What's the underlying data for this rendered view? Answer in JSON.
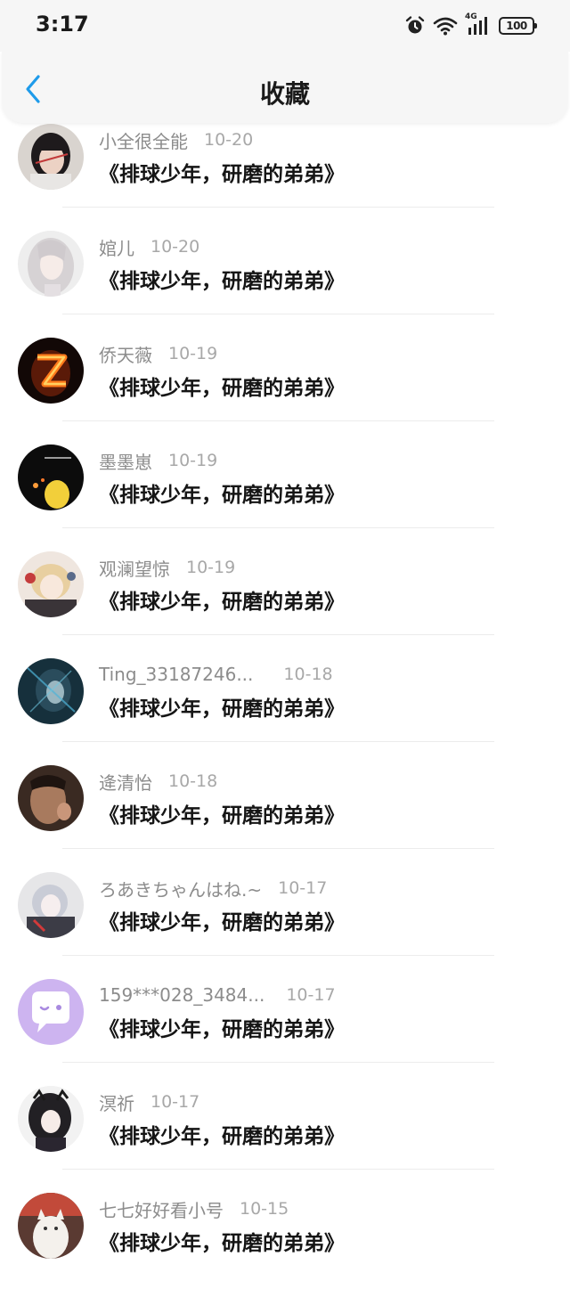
{
  "status_bar": {
    "time": "3:17",
    "network": "4G",
    "battery": "100",
    "icons": [
      "alarm-icon",
      "wifi-icon",
      "signal-icon",
      "battery-icon"
    ]
  },
  "header": {
    "title": "收藏",
    "back_icon": "chevron-left-icon",
    "accent_color": "#1e9bea"
  },
  "items": [
    {
      "username": "小全很全能",
      "date": "10-20",
      "title": "《排球少年，研磨的弟弟》",
      "avatar": "avatar-photo-icon"
    },
    {
      "username": "婠儿",
      "date": "10-20",
      "title": "《排球少年，研磨的弟弟》",
      "avatar": "avatar-anime-icon"
    },
    {
      "username": "侨天薇",
      "date": "10-19",
      "title": "《排球少年，研磨的弟弟》",
      "avatar": "avatar-fire-letter-icon"
    },
    {
      "username": "墨墨崽",
      "date": "10-19",
      "title": "《排球少年，研磨的弟弟》",
      "avatar": "avatar-dark-icon"
    },
    {
      "username": "观澜望惊",
      "date": "10-19",
      "title": "《排球少年，研磨的弟弟》",
      "avatar": "avatar-anime-icon"
    },
    {
      "username": "Ting_33187246...",
      "date": "10-18",
      "title": "《排球少年，研磨的弟弟》",
      "avatar": "avatar-anime-icon"
    },
    {
      "username": "逄清怡",
      "date": "10-18",
      "title": "《排球少年，研磨的弟弟》",
      "avatar": "avatar-photo-icon"
    },
    {
      "username": "ろあきちゃんはね.~",
      "date": "10-17",
      "title": "《排球少年，研磨的弟弟》",
      "avatar": "avatar-anime-icon"
    },
    {
      "username": "159***028_3484...",
      "date": "10-17",
      "title": "《排球少年，研磨的弟弟》",
      "avatar": "avatar-default-chat-icon"
    },
    {
      "username": "溟祈",
      "date": "10-17",
      "title": "《排球少年，研磨的弟弟》",
      "avatar": "avatar-anime-icon"
    },
    {
      "username": "七七好好看小号",
      "date": "10-15",
      "title": "《排球少年，研磨的弟弟》",
      "avatar": "avatar-cat-icon"
    }
  ]
}
